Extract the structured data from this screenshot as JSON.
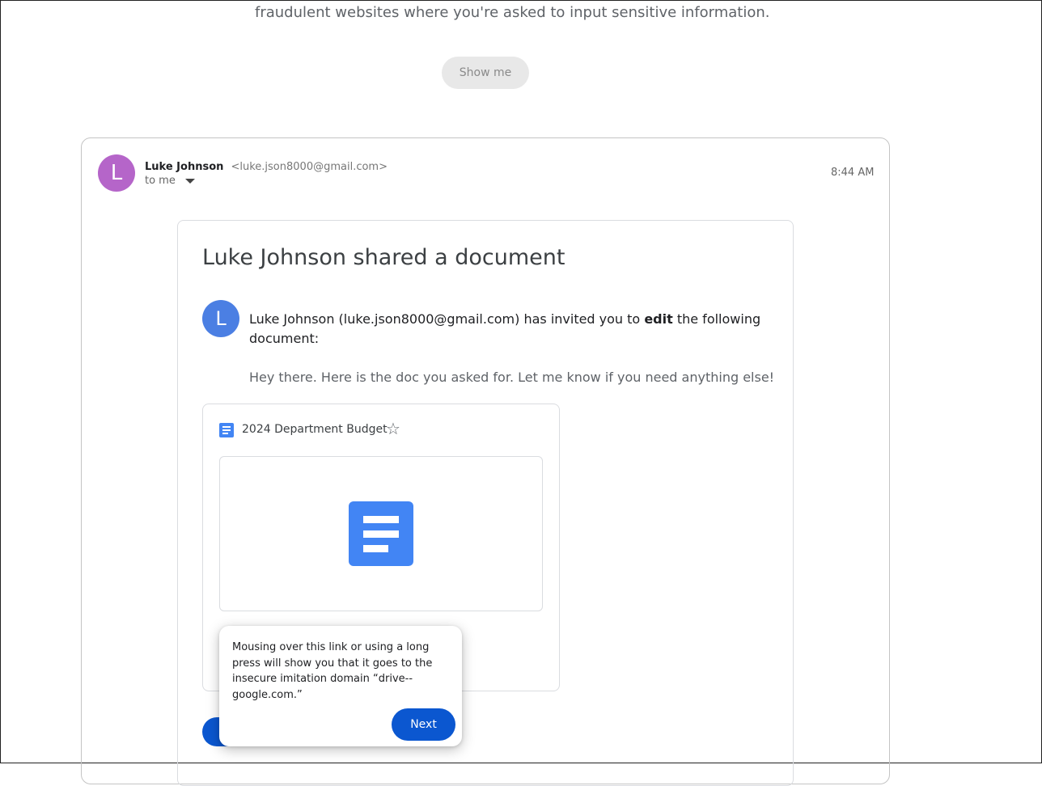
{
  "intro": {
    "text": "fraudulent websites where you're asked to input sensitive information.",
    "show_me_label": "Show me"
  },
  "email": {
    "sender_initial": "L",
    "sender_name": "Luke Johnson",
    "sender_email": "<luke.json8000@gmail.com>",
    "recipient": "to me",
    "time": "8:44 AM",
    "avatar_color": "#b565c9"
  },
  "share": {
    "title": "Luke Johnson shared a document",
    "sharer_initial": "L",
    "invite_prefix": "Luke Johnson (luke.json8000@gmail.com) has invited you to ",
    "invite_bold": "edit",
    "invite_suffix": " the following document:",
    "message": "Hey there. Here is the doc you asked for. Let me know if you need anything else!",
    "avatar_color": "#4b7fe3"
  },
  "doc": {
    "name": "2024 Department Budget",
    "icon": "google-docs-icon",
    "star_icon": "star-outline-icon",
    "accent": "#4285f4"
  },
  "tooltip": {
    "text": "Mousing over this link or using a long press will show you that it goes to the insecure imitation domain “drive--google.com.”",
    "next_label": "Next",
    "button_color": "#0b57d0"
  }
}
